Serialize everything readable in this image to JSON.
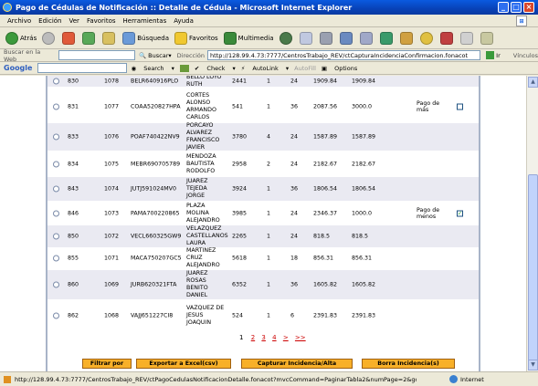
{
  "window": {
    "title": "Pago de Cédulas de Notificación :: Detalle de Cédula - Microsoft Internet Explorer"
  },
  "menu": [
    "Archivo",
    "Edición",
    "Ver",
    "Favoritos",
    "Herramientas",
    "Ayuda"
  ],
  "toolbar": {
    "back": "Atrás",
    "search": "Búsqueda",
    "favorites": "Favoritos",
    "multimedia": "Multimedia"
  },
  "addr": {
    "search_label": "Buscar en la Web",
    "search_btn": "Buscar",
    "direccion": "Dirección",
    "url": "http://128.99.4.73:7777/CentrosTrabajo_REV/ctCapturaIncidenciaConfirmacion.fonacot",
    "go": "Ir",
    "vinculos": "Vínculos"
  },
  "google": {
    "label": "Google",
    "search": "Search",
    "check": "Check",
    "autolink": "AutoLink",
    "autofill": "AutoFill",
    "options": "Options"
  },
  "rows": [
    {
      "a": "830",
      "b": "1078",
      "rfc": "BELR640916PLO",
      "name": [
        "BELLO LOYO",
        "RUTH"
      ],
      "n": "2441",
      "c": "1",
      "d": "24",
      "e": "1909.84",
      "f": "1909.84",
      "pago": "",
      "check": ""
    },
    {
      "a": "831",
      "b": "1077",
      "rfc": "COAA520827HPA",
      "name": [
        "CORTES",
        "ALONSO",
        "ARMANDO",
        "CARLOS"
      ],
      "n": "541",
      "c": "1",
      "d": "36",
      "e": "2087.56",
      "f": "3000.0",
      "pago": "Pago de más",
      "check": ""
    },
    {
      "a": "833",
      "b": "1076",
      "rfc": "POAF740422NV9",
      "name": [
        "PORCAYO",
        "ALVAREZ",
        "FRANCISCO",
        "JAVIER"
      ],
      "n": "3780",
      "c": "4",
      "d": "24",
      "e": "1587.89",
      "f": "1587.89",
      "pago": "",
      "check": ""
    },
    {
      "a": "834",
      "b": "1075",
      "rfc": "MEBR690705789",
      "name": [
        "MENDOZA",
        "BAUTISTA",
        "RODOLFO"
      ],
      "n": "2958",
      "c": "2",
      "d": "24",
      "e": "2182.67",
      "f": "2182.67",
      "pago": "",
      "check": ""
    },
    {
      "a": "843",
      "b": "1074",
      "rfc": "JUTJ591024MV0",
      "name": [
        "JUAREZ",
        "TEJEDA",
        "JORGE"
      ],
      "n": "3924",
      "c": "1",
      "d": "36",
      "e": "1806.54",
      "f": "1806.54",
      "pago": "",
      "check": ""
    },
    {
      "a": "846",
      "b": "1073",
      "rfc": "PAMA700220865",
      "name": [
        "PLAZA",
        "MOLINA",
        "ALEJANDRO"
      ],
      "n": "3985",
      "c": "1",
      "d": "24",
      "e": "2346.37",
      "f": "1000.0",
      "pago": "Pago de menos",
      "check": "✓"
    },
    {
      "a": "850",
      "b": "1072",
      "rfc": "VECL660325GW9",
      "name": [
        "VELAZQUEZ",
        "CASTELLANOS",
        "LAURA"
      ],
      "n": "2265",
      "c": "1",
      "d": "24",
      "e": "818.5",
      "f": "818.5",
      "pago": "",
      "check": ""
    },
    {
      "a": "855",
      "b": "1071",
      "rfc": "MACA750207GC5",
      "name": [
        "MARTINEZ",
        "CRUZ",
        "ALEJANDRO"
      ],
      "n": "5618",
      "c": "1",
      "d": "18",
      "e": "856.31",
      "f": "856.31",
      "pago": "",
      "check": ""
    },
    {
      "a": "860",
      "b": "1069",
      "rfc": "JURB620321FTA",
      "name": [
        "JUAREZ",
        "ROSAS",
        "BENITO",
        "DANIEL"
      ],
      "n": "6352",
      "c": "1",
      "d": "36",
      "e": "1605.82",
      "f": "1605.82",
      "pago": "",
      "check": ""
    },
    {
      "a": "862",
      "b": "1068",
      "rfc": "VAJJ651227CI8",
      "name": [
        "VAZQUEZ DE",
        "JESUS",
        "JOAQUIN"
      ],
      "n": "524",
      "c": "1",
      "d": "6",
      "e": "2391.83",
      "f": "2391.83",
      "pago": "",
      "check": ""
    }
  ],
  "pager": {
    "current": "1",
    "links": [
      "2",
      "3",
      "4",
      ">",
      ">>"
    ]
  },
  "buttons": {
    "filtrar": "Filtrar por",
    "exportar": "Exportar a Excel(csv)",
    "capturar": "Capturar Incidencia/Alta",
    "borrar": "Borra Incidencia(s)"
  },
  "status": {
    "url": "http://128.99.4.73:7777/CentrosTrabajo_REV/ctPagoCedulasNotificacionDetalle.fonacot?mvcCommand=PaginarTabla2&numPage=2&goTo=num",
    "zone": "Internet"
  }
}
